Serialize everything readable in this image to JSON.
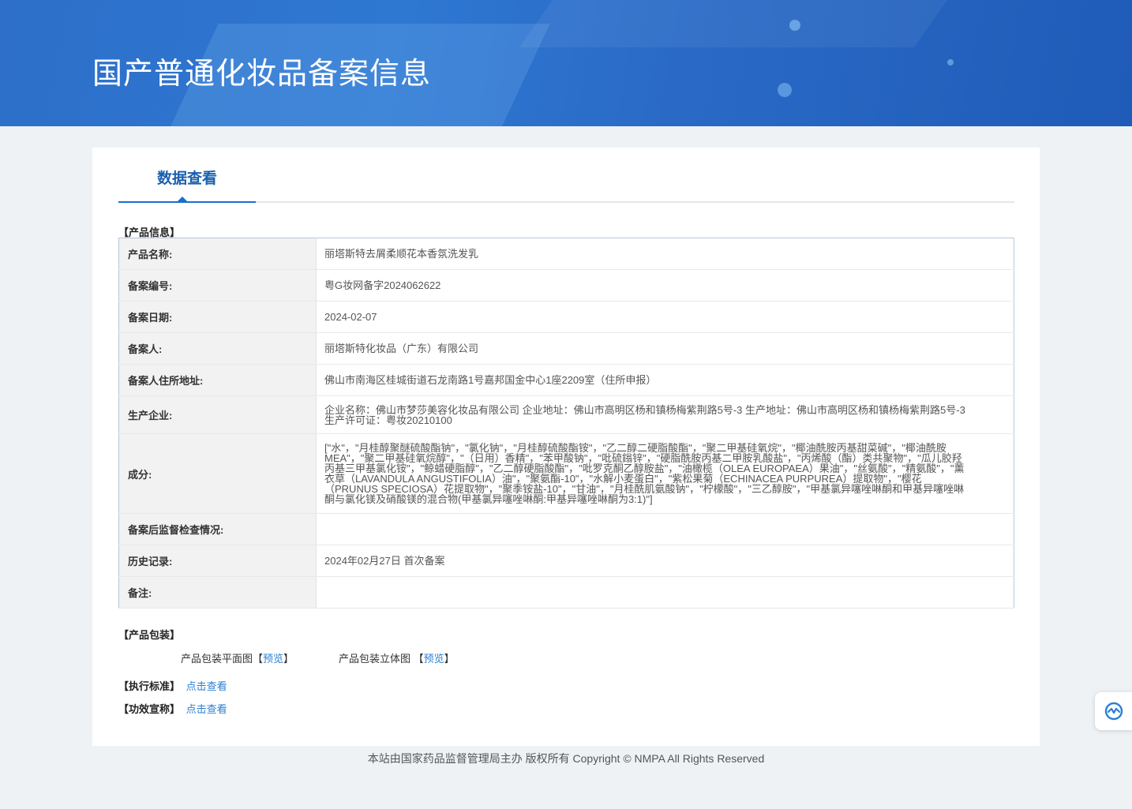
{
  "header": {
    "title": "国产普通化妆品备案信息"
  },
  "tab": {
    "label": "数据查看"
  },
  "sections": {
    "product_info": "【产品信息】",
    "product_packaging": "【产品包装】",
    "exec_standard": "【执行标准】",
    "efficacy_claim": "【功效宣称】"
  },
  "product_info": [
    {
      "key": "产品名称:",
      "value": "丽塔斯特去屑柔顺花本香氛洗发乳"
    },
    {
      "key": "备案编号:",
      "value": "粤G妆网备字2024062622"
    },
    {
      "key": "备案日期:",
      "value": "2024-02-07"
    },
    {
      "key": "备案人:",
      "value": "丽塔斯特化妆品（广东）有限公司"
    },
    {
      "key": "备案人住所地址:",
      "value": "佛山市南海区桂城街道石龙南路1号嘉邦国金中心1座2209室（住所申报）"
    },
    {
      "key": "生产企业:",
      "value": "企业名称：佛山市梦莎美容化妆品有限公司 企业地址：佛山市高明区杨和镇杨梅紫荆路5号-3 生产地址：佛山市高明区杨和镇杨梅紫荆路5号-3 生产许可证：粤妆20210100"
    },
    {
      "key": "成分:",
      "value": "[\"水\"，\"月桂醇聚醚硫酸酯钠\"，\"氯化钠\"，\"月桂醇硫酸酯铵\"，\"乙二醇二硬脂酸酯\"，\"聚二甲基硅氧烷\"，\"椰油酰胺丙基甜菜碱\"，\"椰油酰胺 MEA\"，\"聚二甲基硅氧烷醇\"，\"（日用）香精\"，\"苯甲酸钠\"，\"吡硫鎓锌\"，\"硬脂酰胺丙基二甲胺乳酸盐\"，\"丙烯酸（酯）类共聚物\"，\"瓜儿胶羟丙基三甲基氯化铵\"，\"鲸蜡硬脂醇\"，\"乙二醇硬脂酸酯\"，\"吡罗克酮乙醇胺盐\"，\"油橄榄（OLEA EUROPAEA）果油\"，\"丝氨酸\"，\"精氨酸\"，\"薰衣草（LAVANDULA ANGUSTIFOLIA）油\"，\"聚氨酯-10\"，\"水解小麦蛋白\"，\"紫松果菊（ECHINACEA PURPUREA）提取物\"，\"樱花（PRUNUS SPECIOSA）花提取物\"，\"聚季铵盐-10\"，\"甘油\"，\"月桂酰肌氨酸钠\"，\"柠檬酸\"，\"三乙醇胺\"，\"甲基氯异噻唑啉酮和甲基异噻唑啉酮与氯化镁及硝酸镁的混合物(甲基氯异噻唑啉酮:甲基异噻唑啉酮为3:1)\"]"
    },
    {
      "key": "备案后监督检查情况:",
      "value": ""
    },
    {
      "key": "历史记录:",
      "value": "2024年02月27日 首次备案"
    },
    {
      "key": "备注:",
      "value": ""
    }
  ],
  "packaging": {
    "flat_label": "产品包装平面图",
    "flat_link": "预览",
    "solid_label": "产品包装立体图",
    "solid_link": "预览",
    "bracket_open": "【",
    "bracket_close": "】"
  },
  "links": {
    "exec_standard_link": "点击查看",
    "efficacy_claim_link": "点击查看"
  },
  "footer": {
    "text": "本站由国家药品监督管理局主办 版权所有 Copyright © NMPA All Rights Reserved"
  },
  "icons": {
    "float_button": "accessibility-icon"
  },
  "colors": {
    "banner": "#2d6fc9",
    "accent": "#1a6fc9",
    "link": "#2a7fd4"
  }
}
